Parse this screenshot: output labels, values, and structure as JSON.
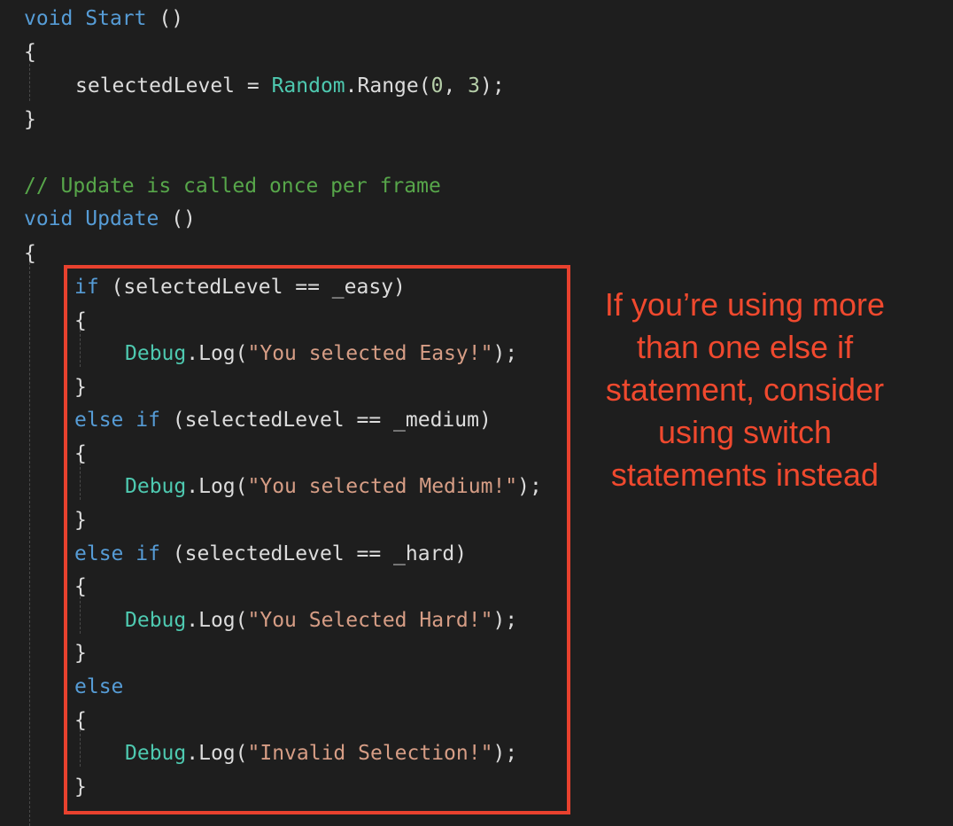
{
  "code": {
    "start_decl": {
      "kw": "void",
      "name": "Start",
      "parens": " ()"
    },
    "open_brace": "{",
    "close_brace": "}",
    "assign": {
      "lhs": "selectedLevel = ",
      "type": "Random",
      "method": ".Range(",
      "arg1": "0",
      "sep": ", ",
      "arg2": "3",
      "end": ");"
    },
    "comment": "// Update is called once per frame",
    "update_decl": {
      "kw": "void",
      "name": "Update",
      "parens": " ()"
    },
    "branches": [
      {
        "kw": "if",
        "cond": " (selectedLevel == _easy)",
        "type": "Debug",
        "call": ".Log(",
        "str": "\"You selected Easy!\"",
        "end": ");"
      },
      {
        "kw": "else if",
        "cond": " (selectedLevel == _medium)",
        "type": "Debug",
        "call": ".Log(",
        "str": "\"You selected Medium!\"",
        "end": ");"
      },
      {
        "kw": "else if",
        "cond": " (selectedLevel == _hard)",
        "type": "Debug",
        "call": ".Log(",
        "str": "\"You Selected Hard!\"",
        "end": ");"
      },
      {
        "kw": "else",
        "cond": "",
        "type": "Debug",
        "call": ".Log(",
        "str": "\"Invalid Selection!\"",
        "end": ");"
      }
    ]
  },
  "annotation": {
    "text": "If you’re using more than one else if statement, consider using switch statements instead",
    "color": "#f0492e"
  }
}
